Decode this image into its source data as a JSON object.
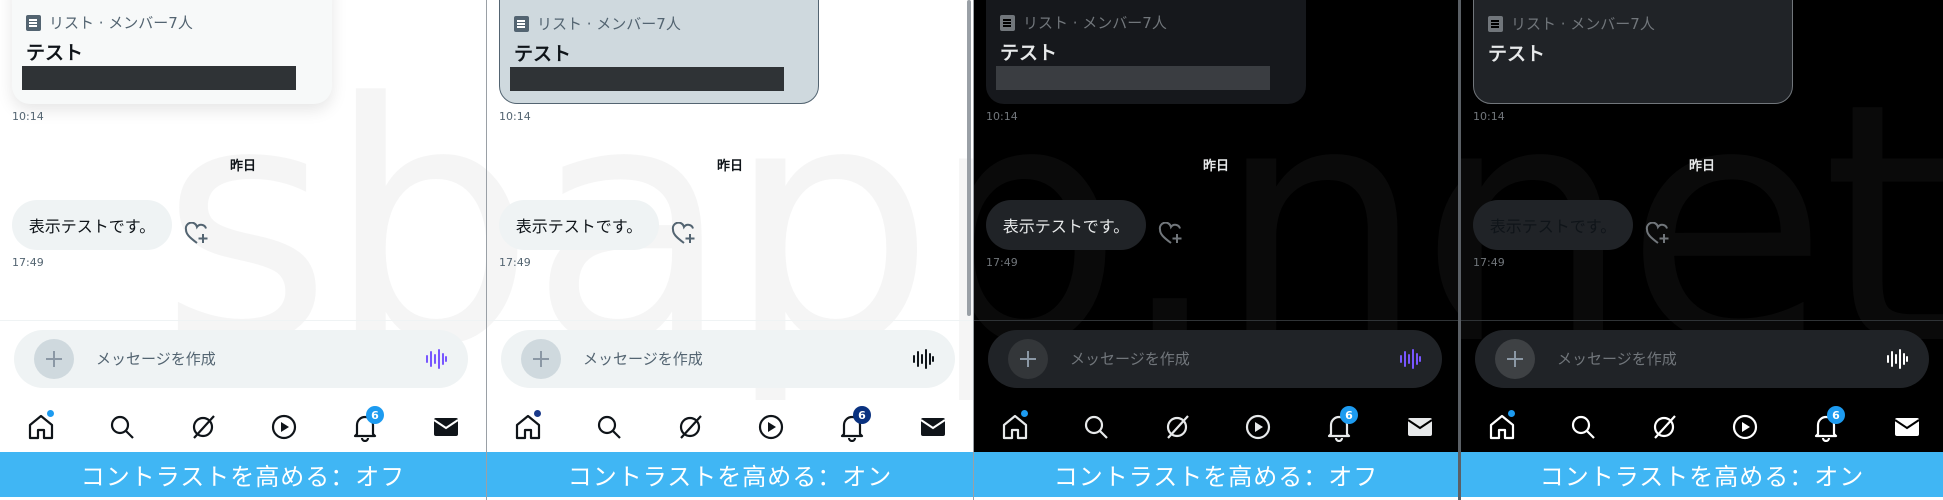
{
  "panels": [
    {
      "theme": "light",
      "contrast": "off",
      "card": {
        "meta": "リスト · メンバー7人",
        "title": "テスト"
      },
      "card_time": "10:14",
      "day_label": "昨日",
      "message": {
        "text": "表示テストです。",
        "time": "17:49"
      },
      "compose_placeholder": "メッセージを作成",
      "notification_count": "6",
      "caption": "コントラストを高める：オフ",
      "colors": {
        "accent": "#1d9bf0",
        "voice": "#7856ff",
        "badge": "#1d9bf0"
      }
    },
    {
      "theme": "light",
      "contrast": "on",
      "card": {
        "meta": "リスト · メンバー7人",
        "title": "テスト"
      },
      "card_time": "10:14",
      "day_label": "昨日",
      "message": {
        "text": "表示テストです。",
        "time": "17:49"
      },
      "compose_placeholder": "メッセージを作成",
      "notification_count": "6",
      "caption": "コントラストを高める：オン",
      "colors": {
        "accent": "#1a3a8a",
        "voice": "#0f1419",
        "badge": "#0a3280"
      }
    },
    {
      "theme": "dark",
      "contrast": "off",
      "card": {
        "meta": "リスト · メンバー7人",
        "title": "テスト"
      },
      "card_time": "10:14",
      "day_label": "昨日",
      "message": {
        "text": "表示テストです。",
        "time": "17:49"
      },
      "compose_placeholder": "メッセージを作成",
      "notification_count": "6",
      "caption": "コントラストを高める：オフ",
      "colors": {
        "accent": "#1d9bf0",
        "voice": "#7856ff",
        "badge": "#1d9bf0"
      }
    },
    {
      "theme": "dark",
      "contrast": "on",
      "card": {
        "meta": "リスト · メンバー7人",
        "title": "テスト"
      },
      "card_time": "10:14",
      "day_label": "昨日",
      "message": {
        "text": "表示テストです。",
        "time": "17:49"
      },
      "compose_placeholder": "メッセージを作成",
      "notification_count": "6",
      "caption": "コントラストを高める：オン",
      "colors": {
        "accent": "#1d9bf0",
        "voice": "#ffffff",
        "badge": "#1d9bf0"
      }
    }
  ],
  "nav_icons": [
    "home-icon",
    "search-icon",
    "grok-icon",
    "video-icon",
    "bell-icon",
    "mail-icon"
  ],
  "watermark": "sbapp.net"
}
